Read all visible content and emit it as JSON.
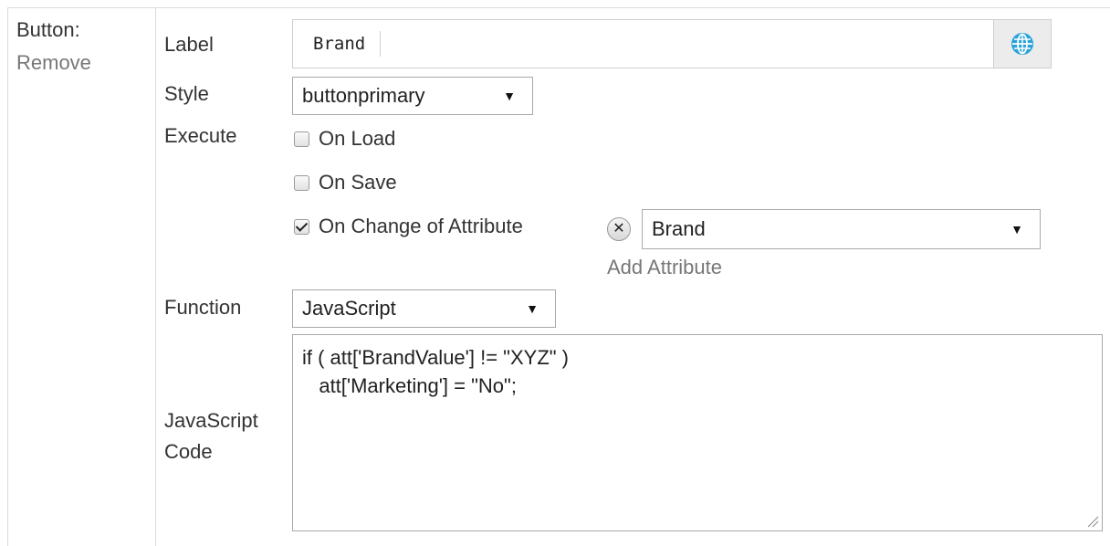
{
  "section": {
    "title": "Button:",
    "remove_link": "Remove"
  },
  "fields": {
    "label_label": "Label",
    "style_label": "Style",
    "execute_label": "Execute",
    "function_label": "Function",
    "code_label_line1": "JavaScript",
    "code_label_line2": "Code"
  },
  "label_input": {
    "value": "Brand",
    "globe_icon": "globe-icon"
  },
  "style_select": {
    "selected": "buttonprimary"
  },
  "execute": {
    "on_load": {
      "label": "On Load",
      "checked": false
    },
    "on_save": {
      "label": "On Save",
      "checked": false
    },
    "on_change": {
      "label": "On Change of Attribute",
      "checked": true
    }
  },
  "attribute": {
    "selected": "Brand",
    "remove_icon": "close-circle-icon",
    "add_link": "Add Attribute"
  },
  "function_select": {
    "selected": "JavaScript"
  },
  "code": {
    "line1": "if ( att['BrandValue'] != \"XYZ\" )",
    "line2": "   att['Marketing'] = \"No\";"
  },
  "dropdown_icon": "triangle-down-icon"
}
